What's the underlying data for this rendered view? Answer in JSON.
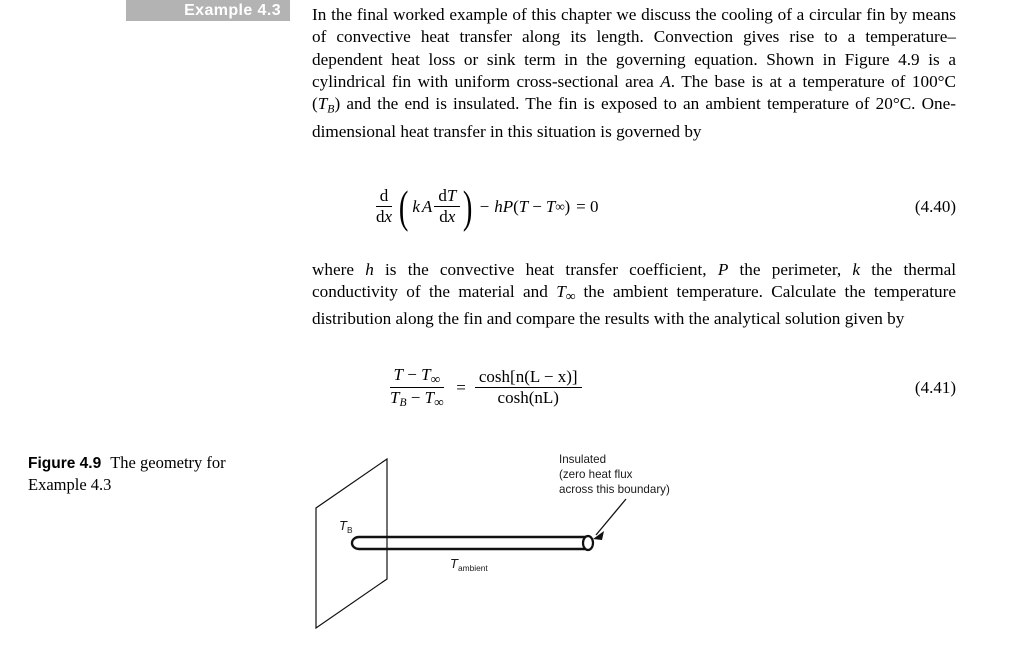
{
  "example_tag": {
    "label": "Example 4.3"
  },
  "paragraphs": {
    "p1_part1": "In the final worked example of this chapter we discuss the cooling of a circular fin by means of convective heat transfer along its length. Convection gives rise to a temperature–dependent heat loss or sink term in the governing equation. Shown in Figure 4.9 is a cylindrical fin with uniform cross-sectional area ",
    "p1_var_A": "A",
    "p1_part2": ". The base is at a temperature of 100°C (",
    "p1_var_TB": "T",
    "p1_var_TB_sub": "B",
    "p1_part3": ") and the end is insulated. The fin is exposed to an ambient temperature of 20°C. One-dimensional heat transfer in this situation is governed by",
    "p2_part1": "where ",
    "p2_var_h": "h",
    "p2_part2": " is the convective heat transfer coefficient, ",
    "p2_var_P": "P",
    "p2_part3": " the perimeter, ",
    "p2_var_k": "k",
    "p2_part4": " the thermal conductivity of the material and ",
    "p2_var_T": "T",
    "p2_var_T_sub": "∞",
    "p2_part5": " the ambient temperature. Calculate the temperature distribution along the fin and compare the results with the analytical solution given by"
  },
  "equations": {
    "eq440": {
      "number": "(4.40)",
      "d_num": "d",
      "d_den": "d",
      "d_den_var": "x",
      "k": "k",
      "A": "A",
      "dT_num": "d",
      "dT_num_var": "T",
      "dT_den": "d",
      "dT_den_var": "x",
      "minus": "−",
      "h": "h",
      "P": "P",
      "open": "(",
      "T": "T",
      "inner_minus": "−",
      "T_inf": "T",
      "T_inf_sub": "∞",
      "close": ")",
      "equals": "= 0"
    },
    "eq441": {
      "number": "(4.41)",
      "lhs_num_T": "T",
      "lhs_num_minus": " − ",
      "lhs_num_Tinf": "T",
      "lhs_num_Tinf_sub": "∞",
      "lhs_den_TB": "T",
      "lhs_den_TB_sub": "B",
      "lhs_den_minus": " − ",
      "lhs_den_Tinf": "T",
      "lhs_den_Tinf_sub": "∞",
      "equals": "=",
      "rhs_num": "cosh[n(L − x)]",
      "rhs_den": "cosh(nL)"
    }
  },
  "figure": {
    "caption_label": "Figure 4.9",
    "caption_text": "The geometry for Example 4.3",
    "annotation_line1": "Insulated",
    "annotation_line2": "(zero heat flux",
    "annotation_line3": "across this boundary)",
    "label_base": "T",
    "label_base_sub": "B",
    "label_ambient": "T",
    "label_ambient_sub": "ambient"
  },
  "colors": {
    "tag_background": "#b3b3b3",
    "tag_text": "#ffffff",
    "ink": "#000000",
    "page_background": "#ffffff"
  }
}
